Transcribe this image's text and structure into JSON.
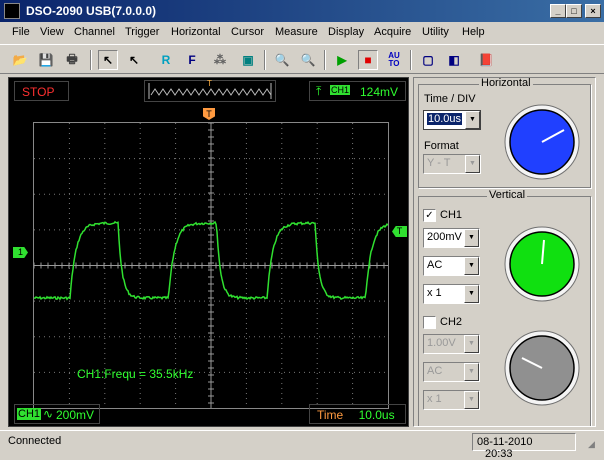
{
  "window": {
    "title": "DSO-2090 USB(7.0.0.0)",
    "min_glyph": "_",
    "max_glyph": "□",
    "close_glyph": "×"
  },
  "menu": [
    "File",
    "View",
    "Channel",
    "Trigger",
    "Horizontal",
    "Cursor",
    "Measure",
    "Display",
    "Acquire",
    "Utility",
    "Help"
  ],
  "toolbar": {
    "items": [
      {
        "name": "open-icon",
        "glyph": "📂",
        "color": "#c89000"
      },
      {
        "name": "save-icon",
        "glyph": "💾",
        "color": "#000080"
      },
      {
        "name": "print-icon",
        "glyph": "🖶",
        "color": "#404040"
      },
      {
        "name": "pointer-icon",
        "glyph": "↖",
        "color": "#000"
      },
      {
        "name": "select-icon",
        "glyph": "↖",
        "color": "#000"
      },
      {
        "name": "reference-icon",
        "glyph": "R",
        "color": "#00a0c0"
      },
      {
        "name": "fft-icon",
        "glyph": "F",
        "color": "#000080"
      },
      {
        "name": "math-icon",
        "glyph": "⁂",
        "color": "#606060"
      },
      {
        "name": "display-icon",
        "glyph": "▣",
        "color": "#008080"
      },
      {
        "name": "zoom-in-icon",
        "glyph": "🔍",
        "color": "#404040"
      },
      {
        "name": "zoom-out-icon",
        "glyph": "🔍",
        "color": "#404040"
      },
      {
        "name": "run-icon",
        "glyph": "▶",
        "color": "#00a000"
      },
      {
        "name": "stop-icon",
        "glyph": "■",
        "color": "#e00000"
      },
      {
        "name": "autoset-icon",
        "glyph": "AU TO",
        "color": "#0000c0"
      },
      {
        "name": "fit-icon",
        "glyph": "▢",
        "color": "#000080"
      },
      {
        "name": "panel-icon",
        "glyph": "◧",
        "color": "#000080"
      },
      {
        "name": "book-icon",
        "glyph": "📕",
        "color": "#a000a0"
      }
    ]
  },
  "scope": {
    "run_state": "STOP",
    "trigger_marker": "T",
    "trigger_channel": "CH1",
    "trigger_level": "124mV",
    "ch1_marker": "1",
    "trigger_level_marker": "T",
    "measurement": "CH1:Frequ = 35.5kHz",
    "ch1_label": "CH1",
    "ch1_coupling_glyph": "∿",
    "ch1_scale": "200mV",
    "time_label": "Time",
    "time_value": "10.0us",
    "trace_color": "#30e030"
  },
  "horizontal": {
    "title": "Horizontal",
    "time_div_label": "Time / DIV",
    "time_div_value": "10.0us",
    "format_label": "Format",
    "format_value": "Y - T",
    "knob_color": "#2040ff"
  },
  "vertical": {
    "title": "Vertical",
    "ch1": {
      "label": "CH1",
      "checked": true,
      "check_glyph": "✓",
      "volts": "200mV",
      "coupling": "AC",
      "probe": "x 1",
      "knob_color": "#10e010"
    },
    "ch2": {
      "label": "CH2",
      "checked": false,
      "volts": "1.00V",
      "coupling": "AC",
      "probe": "x 1",
      "knob_color": "#909090"
    }
  },
  "status": {
    "text": "Connected",
    "date": "08-11-2010",
    "time": "20:33"
  }
}
